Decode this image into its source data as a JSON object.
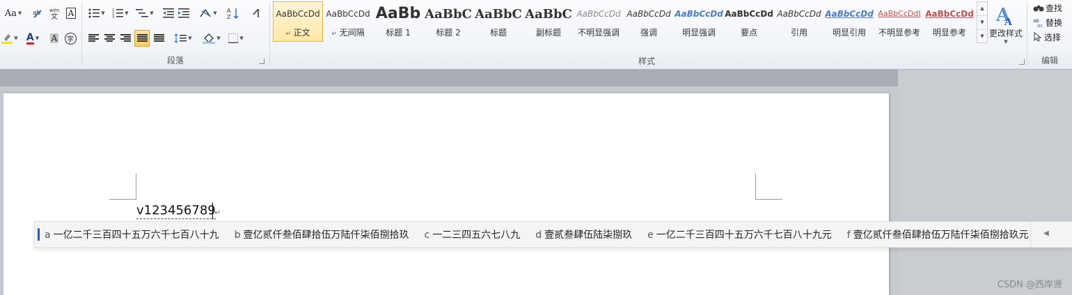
{
  "ribbon": {
    "font_group": {
      "change_case": "Aa",
      "phonetic": "ab",
      "char_border": "A",
      "font_color": "A",
      "char_shading": "A",
      "enclosed": "字"
    },
    "paragraph_group": {
      "label": "段落"
    },
    "styles_group": {
      "label": "样式",
      "tiles": [
        {
          "preview": "AaBbCcDd",
          "name": "正文",
          "mark": "↵"
        },
        {
          "preview": "AaBbCcDd",
          "name": "无间隔",
          "mark": "↵"
        },
        {
          "preview": "AaBb",
          "name": "标题 1"
        },
        {
          "preview": "AaBbC",
          "name": "标题 2"
        },
        {
          "preview": "AaBbC",
          "name": "标题"
        },
        {
          "preview": "AaBbC",
          "name": "副标题"
        },
        {
          "preview": "AaBbCcDd",
          "name": "不明显强调"
        },
        {
          "preview": "AaBbCcDd",
          "name": "强调"
        },
        {
          "preview": "AaBbCcDd",
          "name": "明显强调"
        },
        {
          "preview": "AaBbCcDd",
          "name": "要点"
        },
        {
          "preview": "AaBbCcDd",
          "name": "引用"
        },
        {
          "preview": "AaBbCcDd",
          "name": "明显引用"
        },
        {
          "preview": "AaBbCcDdI",
          "name": "不明显参考"
        },
        {
          "preview": "AaBbCcDd",
          "name": "明显参考"
        }
      ],
      "change_styles": "更改样式"
    },
    "editing_group": {
      "label": "编辑",
      "find": "查找",
      "replace": "替换",
      "select": "选择"
    }
  },
  "document": {
    "text": "v123456789",
    "para_mark": "↵"
  },
  "ime": {
    "candidates": [
      {
        "key": "a",
        "text": "一亿二千三百四十五万六千七百八十九"
      },
      {
        "key": "b",
        "text": "壹亿贰仟叁佰肆拾伍万陆仟柒佰捌拾玖"
      },
      {
        "key": "c",
        "text": "一二三四五六七八九"
      },
      {
        "key": "d",
        "text": "壹贰叁肆伍陆柒捌玖"
      },
      {
        "key": "e",
        "text": "一亿二千三百四十五万六千七百八十九元"
      },
      {
        "key": "f",
        "text": "壹亿贰仟叁佰肆拾伍万陆仟柒佰捌拾玖元"
      }
    ],
    "prev_arrow": "◀"
  },
  "watermark": "CSDN @西岸贤",
  "colors": {
    "accent_selected": "#e7b23b",
    "ime_cursor": "#1e5bb8",
    "font_color_bar": "#e01b1b",
    "highlight_bar": "#f7e500"
  }
}
